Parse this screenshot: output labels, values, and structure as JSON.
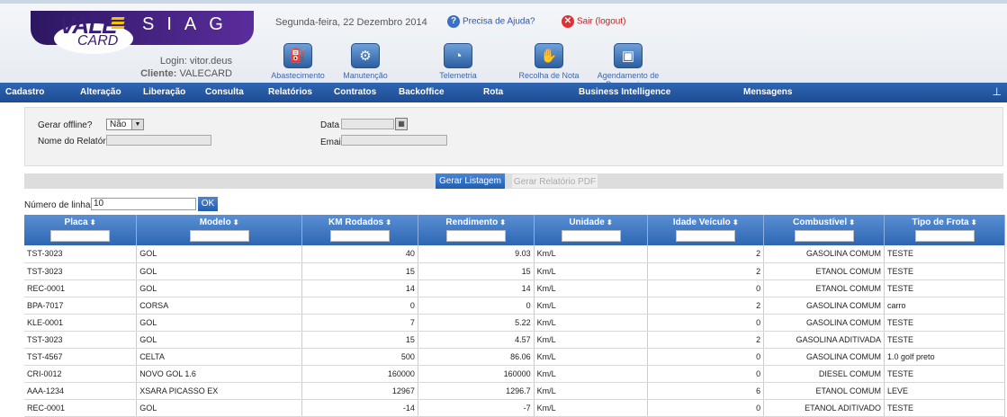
{
  "header": {
    "brand_vale": "VALE",
    "brand_card": "CARD",
    "brand_system": "SIAG",
    "login_label": "Login:",
    "login_user": "vitor.deus",
    "client_label": "Cliente:",
    "client_name": "VALECARD",
    "date": "Segunda-feira, 22 Dezembro 2014",
    "help": "Precisa de Ajuda?",
    "logout": "Sair (logout)"
  },
  "modules": [
    {
      "label": "Abastecimento",
      "icon": "fuel-pump-icon"
    },
    {
      "label": "Manutenção",
      "icon": "wrench-icon"
    },
    {
      "label": "Telemetria",
      "icon": "signal-icon"
    },
    {
      "label": "Recolha de Nota",
      "icon": "hand-receipt-icon"
    },
    {
      "label": "Agendamento de Passageiros",
      "icon": "bus-icon"
    }
  ],
  "menu": [
    "Cadastro",
    "Alteração",
    "Liberação",
    "Consulta",
    "Relatórios",
    "Contratos",
    "Backoffice",
    "Rota",
    "Business Intelligence",
    "Mensagens"
  ],
  "form": {
    "offline_label": "Gerar offline?",
    "offline_value": "Não",
    "report_name_label": "Nome do Relatório",
    "date_label": "Data",
    "email_label": "Email"
  },
  "buttons": {
    "list": "Gerar Listagem",
    "pdf": "Gerar Relatório PDF"
  },
  "rows_control": {
    "label": "Número de linhas:",
    "value": "10",
    "ok": "OK"
  },
  "table": {
    "columns": [
      "Placa",
      "Modelo",
      "KM Rodados",
      "Rendimento",
      "Unidade",
      "Idade Veículo",
      "Combustível",
      "Tipo de Frota"
    ],
    "rows": [
      [
        "TST-3023",
        "GOL",
        "40",
        "9.03",
        "Km/L",
        "2",
        "GASOLINA COMUM",
        "TESTE"
      ],
      [
        "TST-3023",
        "GOL",
        "15",
        "15",
        "Km/L",
        "2",
        "ETANOL COMUM",
        "TESTE"
      ],
      [
        "REC-0001",
        "GOL",
        "14",
        "14",
        "Km/L",
        "0",
        "ETANOL COMUM",
        "TESTE"
      ],
      [
        "BPA-7017",
        "CORSA",
        "0",
        "0",
        "Km/L",
        "2",
        "GASOLINA COMUM",
        "carro"
      ],
      [
        "KLE-0001",
        "GOL",
        "7",
        "5.22",
        "Km/L",
        "0",
        "GASOLINA COMUM",
        "TESTE"
      ],
      [
        "TST-3023",
        "GOL",
        "15",
        "4.57",
        "Km/L",
        "2",
        "GASOLINA ADITIVADA",
        "TESTE"
      ],
      [
        "TST-4567",
        "CELTA",
        "500",
        "86.06",
        "Km/L",
        "0",
        "GASOLINA COMUM",
        "1.0 golf preto"
      ],
      [
        "CRI-0012",
        "NOVO GOL 1.6",
        "160000",
        "160000",
        "Km/L",
        "0",
        "DIESEL COMUM",
        "TESTE"
      ],
      [
        "AAA-1234",
        "XSARA PICASSO EX",
        "12967",
        "1296.7",
        "Km/L",
        "6",
        "ETANOL COMUM",
        "LEVE"
      ],
      [
        "REC-0001",
        "GOL",
        "-14",
        "-7",
        "Km/L",
        "0",
        "ETANOL ADITIVADO",
        "TESTE"
      ]
    ]
  },
  "colors": {
    "menu": "#1d4c93",
    "header_cell": "#3a74bf",
    "brand_purple": "#3a1d78",
    "accent_yellow": "#f2c400"
  }
}
